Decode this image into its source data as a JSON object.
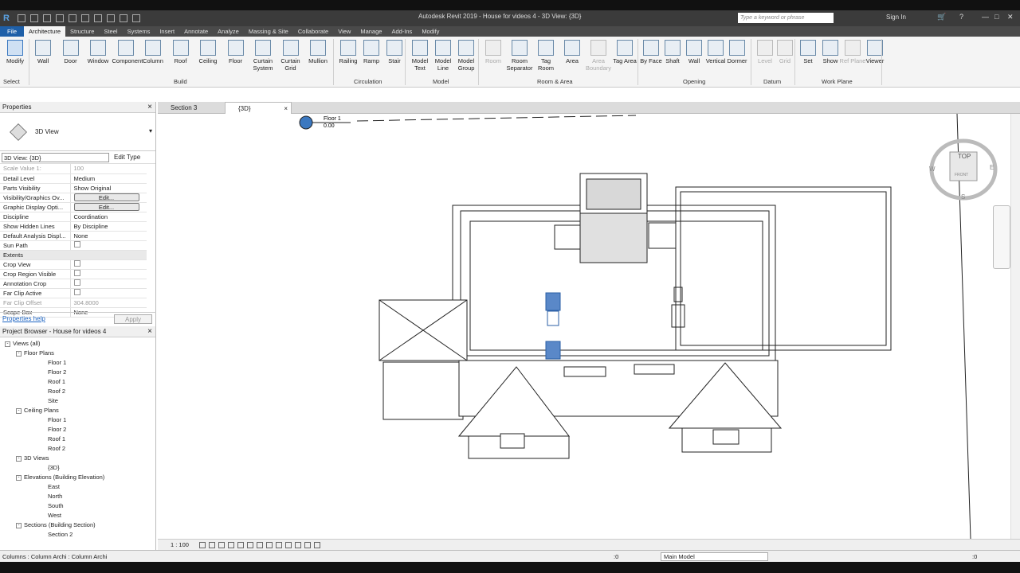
{
  "title_bar": {
    "app_logo": "R",
    "title": "Autodesk Revit 2019 - House for videos 4 - 3D View: {3D}",
    "search_placeholder": "Type a keyword or phrase",
    "sign_in": "Sign In"
  },
  "ribbon_tabs": [
    "File",
    "Architecture",
    "Structure",
    "Steel",
    "Systems",
    "Insert",
    "Annotate",
    "Analyze",
    "Massing & Site",
    "Collaborate",
    "View",
    "Manage",
    "Add-Ins",
    "Modify"
  ],
  "active_tab": "Architecture",
  "ribbon": {
    "select": {
      "modify": "Modify",
      "label": "Select"
    },
    "build": {
      "label": "Build",
      "buttons": [
        "Wall",
        "Door",
        "Window",
        "Component",
        "Column",
        "Roof",
        "Ceiling",
        "Floor",
        "Curtain System",
        "Curtain Grid",
        "Mullion"
      ]
    },
    "circulation": {
      "label": "Circulation",
      "buttons": [
        "Railing",
        "Ramp",
        "Stair"
      ]
    },
    "model": {
      "label": "Model",
      "buttons": [
        "Model Text",
        "Model Line",
        "Model Group"
      ]
    },
    "room_area": {
      "label": "Room & Area",
      "buttons": [
        "Room",
        "Room Separator",
        "Tag Room",
        "Area",
        "Area Boundary",
        "Tag Area"
      ]
    },
    "opening": {
      "label": "Opening",
      "buttons": [
        "By Face",
        "Shaft",
        "Wall",
        "Vertical",
        "Dormer"
      ]
    },
    "datum": {
      "label": "Datum",
      "buttons": [
        "Level",
        "Grid"
      ]
    },
    "work_plane": {
      "label": "Work Plane",
      "buttons": [
        "Set",
        "Show",
        "Ref Plane",
        "Viewer"
      ]
    }
  },
  "properties": {
    "header": "Properties",
    "type_name": "3D View",
    "instance_filter": "3D View: {3D}",
    "edit_type": "Edit Type",
    "rows": [
      {
        "k": "Scale Value    1:",
        "v": "100",
        "gray": true
      },
      {
        "k": "Detail Level",
        "v": "Medium"
      },
      {
        "k": "Parts Visibility",
        "v": "Show Original"
      },
      {
        "k": "Visibility/Graphics Ov...",
        "v": "Edit...",
        "button": true
      },
      {
        "k": "Graphic Display Opti...",
        "v": "Edit...",
        "button": true
      },
      {
        "k": "Discipline",
        "v": "Coordination"
      },
      {
        "k": "Show Hidden Lines",
        "v": "By Discipline"
      },
      {
        "k": "Default Analysis Displ...",
        "v": "None"
      },
      {
        "k": "Sun Path",
        "v": "",
        "check": true
      }
    ],
    "extents_group": "Extents",
    "extents_rows": [
      {
        "k": "Crop View",
        "v": "",
        "check": true
      },
      {
        "k": "Crop Region Visible",
        "v": "",
        "check": true
      },
      {
        "k": "Annotation Crop",
        "v": "",
        "check": true
      },
      {
        "k": "Far Clip Active",
        "v": "",
        "check": true
      },
      {
        "k": "Far Clip Offset",
        "v": "304.8000",
        "gray": true
      },
      {
        "k": "Scope Box",
        "v": "None"
      }
    ],
    "help_link": "Properties help",
    "apply": "Apply"
  },
  "project_browser": {
    "header": "Project Browser - House for videos 4",
    "nodes": [
      {
        "t": "Views (all)",
        "lvl": 0,
        "tog": "-"
      },
      {
        "t": "Floor Plans",
        "lvl": 1,
        "tog": "-"
      },
      {
        "t": "Floor 1",
        "lvl": 2
      },
      {
        "t": "Floor 2",
        "lvl": 2
      },
      {
        "t": "Roof 1",
        "lvl": 2
      },
      {
        "t": "Roof 2",
        "lvl": 2
      },
      {
        "t": "Site",
        "lvl": 2
      },
      {
        "t": "Ceiling Plans",
        "lvl": 1,
        "tog": "-"
      },
      {
        "t": "Floor 1",
        "lvl": 2
      },
      {
        "t": "Floor 2",
        "lvl": 2
      },
      {
        "t": "Roof 1",
        "lvl": 2
      },
      {
        "t": "Roof 2",
        "lvl": 2
      },
      {
        "t": "3D Views",
        "lvl": 1,
        "tog": "-"
      },
      {
        "t": "{3D}",
        "lvl": 2
      },
      {
        "t": "Elevations (Building Elevation)",
        "lvl": 1,
        "tog": "-"
      },
      {
        "t": "East",
        "lvl": 2
      },
      {
        "t": "North",
        "lvl": 2
      },
      {
        "t": "South",
        "lvl": 2
      },
      {
        "t": "West",
        "lvl": 2
      },
      {
        "t": "Sections (Building Section)",
        "lvl": 1,
        "tog": "-"
      },
      {
        "t": "Section 2",
        "lvl": 2
      }
    ]
  },
  "view_tabs": [
    {
      "label": "Section 3",
      "active": false
    },
    {
      "label": "{3D}",
      "active": true
    }
  ],
  "viewport": {
    "level_tag": "Floor 1",
    "level_value": "0.00",
    "viewcube_face": "TOP",
    "viewcube_front": "FRONT",
    "compass": {
      "w": "W",
      "e": "E",
      "s": "S"
    }
  },
  "view_control_bar": {
    "scale": "1 : 100"
  },
  "status_bar": {
    "message": "Columns : Column Archi : Column Archi",
    "worksets": ":0",
    "model": "Main Model",
    "filter": ":0"
  },
  "colors": {
    "file_tab": "#1e5fa8",
    "selection": "#3b78c0",
    "title_bar": "#3b3b3b"
  }
}
